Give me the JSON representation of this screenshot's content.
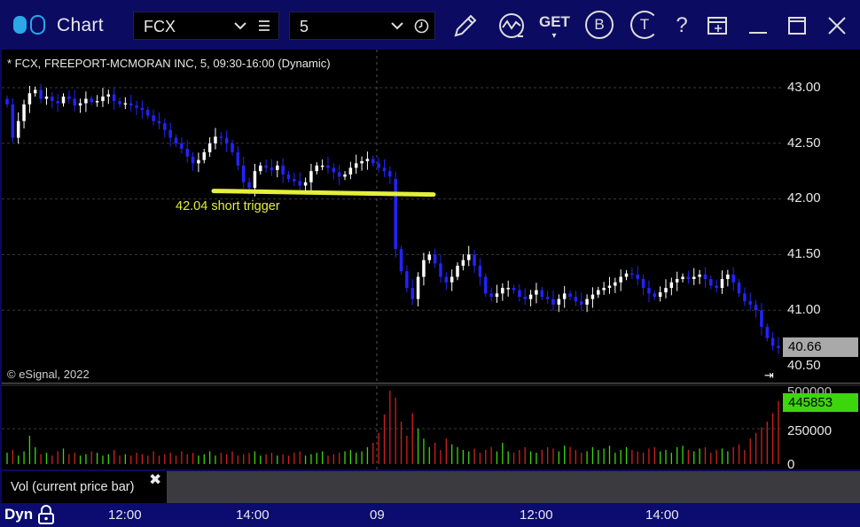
{
  "app": {
    "title": "Chart"
  },
  "toolbar": {
    "symbol": "FCX",
    "interval": "5",
    "icons": [
      "toggle-icon",
      "chevron-down-icon",
      "menu-icon",
      "clock-icon",
      "pencil-icon",
      "study-icon",
      "get-icon",
      "b-icon",
      "t-icon",
      "help-icon",
      "edit-icon",
      "minimize-icon",
      "maximize-icon",
      "close-icon"
    ],
    "get_label": "GET",
    "b_label": "B",
    "t_label": "T",
    "help_label": "?"
  },
  "chart": {
    "title": "* FCX, FREEPORT-MCMORAN INC, 5, 09:30-16:00 (Dynamic)",
    "copyright": "© eSignal, 2022",
    "annotation": "42.04 short trigger",
    "price_axis": [
      "43.00",
      "42.50",
      "42.00",
      "41.50",
      "41.00",
      "40.50"
    ],
    "last_price": "40.66",
    "volume_axis": [
      "500000",
      "250000",
      "0"
    ],
    "last_volume": "445853",
    "time_axis": [
      "12:00",
      "14:00",
      "09",
      "12:00",
      "14:00"
    ],
    "legend": "Vol (current price bar)",
    "legend_close": "✖",
    "dyn_label": "Dyn",
    "goto_end": "⇥",
    "colors": {
      "up": "#ffffff",
      "down": "#2323ff",
      "vol_up": "#3cd60c",
      "vol_down": "#d02020",
      "trigger": "#e4f03a"
    }
  },
  "chart_data": {
    "type": "candlestick",
    "title": "* FCX, FREEPORT-MCMORAN INC, 5, 09:30-16:00 (Dynamic)",
    "ylim": [
      40.5,
      43.2
    ],
    "trigger_level": 42.04,
    "closes": [
      42.85,
      42.55,
      42.7,
      42.85,
      42.95,
      42.98,
      42.9,
      42.92,
      42.88,
      42.86,
      42.92,
      42.9,
      42.84,
      42.86,
      42.9,
      42.87,
      42.88,
      42.92,
      42.94,
      42.88,
      42.85,
      42.86,
      42.84,
      42.82,
      42.8,
      42.75,
      42.7,
      42.68,
      42.62,
      42.55,
      42.5,
      42.45,
      42.38,
      42.32,
      42.35,
      42.42,
      42.5,
      42.56,
      42.55,
      42.5,
      42.42,
      42.3,
      42.15,
      42.1,
      42.25,
      42.3,
      42.28,
      42.26,
      42.3,
      42.22,
      42.18,
      42.16,
      42.12,
      42.15,
      42.25,
      42.3,
      42.3,
      42.28,
      42.24,
      42.2,
      42.22,
      42.28,
      42.32,
      42.34,
      42.36,
      42.32,
      42.28,
      42.25,
      42.2,
      41.55,
      41.35,
      41.2,
      41.1,
      41.3,
      41.45,
      41.5,
      41.42,
      41.3,
      41.25,
      41.3,
      41.4,
      41.45,
      41.5,
      41.4,
      41.3,
      41.15,
      41.12,
      41.15,
      41.2,
      41.2,
      41.18,
      41.12,
      41.1,
      41.14,
      41.18,
      41.12,
      41.1,
      41.05,
      41.1,
      41.15,
      41.12,
      41.08,
      41.05,
      41.1,
      41.14,
      41.18,
      41.2,
      41.22,
      41.25,
      41.3,
      41.33,
      41.32,
      41.28,
      41.2,
      41.15,
      41.12,
      41.16,
      41.2,
      41.25,
      41.28,
      41.3,
      41.28,
      41.3,
      41.32,
      41.28,
      41.22,
      41.2,
      41.28,
      41.32,
      41.25,
      41.15,
      41.08,
      41.05,
      41.0,
      40.85,
      40.75,
      40.68,
      40.66
    ],
    "volumes": [
      80000,
      100000,
      60000,
      90000,
      200000,
      120000,
      70000,
      80000,
      60000,
      90000,
      110000,
      70000,
      80000,
      60000,
      70000,
      90000,
      80000,
      60000,
      70000,
      100000,
      60000,
      70000,
      60000,
      80000,
      70000,
      60000,
      90000,
      60000,
      70000,
      80000,
      60000,
      90000,
      70000,
      80000,
      60000,
      70000,
      90000,
      60000,
      80000,
      70000,
      90000,
      60000,
      70000,
      80000,
      90000,
      60000,
      70000,
      80000,
      60000,
      70000,
      60000,
      80000,
      90000,
      60000,
      70000,
      80000,
      90000,
      60000,
      70000,
      80000,
      90000,
      100000,
      80000,
      90000,
      120000,
      150000,
      220000,
      350000,
      520000,
      470000,
      300000,
      200000,
      360000,
      250000,
      180000,
      120000,
      150000,
      100000,
      180000,
      140000,
      120000,
      100000,
      90000,
      110000,
      80000,
      100000,
      120000,
      90000,
      150000,
      90000,
      80000,
      100000,
      120000,
      90000,
      80000,
      100000,
      120000,
      110000,
      90000,
      130000,
      120000,
      100000,
      80000,
      90000,
      120000,
      100000,
      110000,
      130000,
      80000,
      100000,
      120000,
      100000,
      90000,
      80000,
      110000,
      120000,
      90000,
      100000,
      80000,
      120000,
      130000,
      100000,
      90000,
      110000,
      120000,
      80000,
      100000,
      110000,
      90000,
      120000,
      140000,
      100000,
      180000,
      220000,
      260000,
      300000,
      360000,
      445853
    ]
  }
}
